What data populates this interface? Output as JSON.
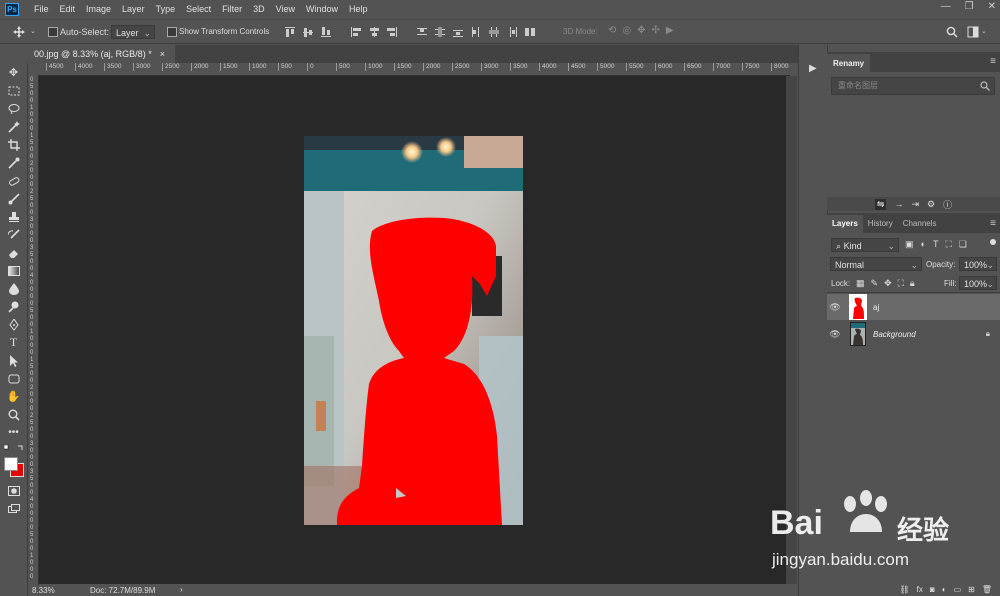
{
  "app": {
    "logo_text": "Ps"
  },
  "menu": [
    "File",
    "Edit",
    "Image",
    "Layer",
    "Type",
    "Select",
    "Filter",
    "3D",
    "View",
    "Window",
    "Help"
  ],
  "options_bar": {
    "auto_select_label": "Auto-Select:",
    "auto_select_target": "Layer",
    "show_transform_label": "Show Transform Controls",
    "mode_3d_label": "3D Mode:"
  },
  "document": {
    "tab_title": "00.jpg @ 8.33% (aj, RGB/8) *",
    "close_glyph": "×"
  },
  "ruler": {
    "h_labels": [
      "4500",
      "4000",
      "3500",
      "3000",
      "2500",
      "2000",
      "1500",
      "1000",
      "500",
      "0",
      "500",
      "1000",
      "1500",
      "2000",
      "2500",
      "3000",
      "3500",
      "4000",
      "4500",
      "5000",
      "5500",
      "6000",
      "6500",
      "7000",
      "7500",
      "8000"
    ]
  },
  "status": {
    "zoom": "8.33%",
    "doc": "Doc: 72.7M/89.9M",
    "arrow": "›"
  },
  "renamy": {
    "tab": "Renamy",
    "search_placeholder": "重命名图层"
  },
  "layers_panel": {
    "tabs": [
      "Layers",
      "History",
      "Channels"
    ],
    "filter_kind": "Kind",
    "blend_mode": "Normal",
    "opacity_label": "Opacity:",
    "opacity_value": "100%",
    "lock_label": "Lock:",
    "fill_label": "Fill:",
    "fill_value": "100%",
    "layers": [
      {
        "name": "aj",
        "selected": true
      },
      {
        "name": "Background",
        "selected": false
      }
    ]
  },
  "watermark": {
    "brand": "Bai",
    "brand2": "经验",
    "url": "jingyan.baidu.com"
  },
  "colors": {
    "foreground": "#ffffff",
    "background": "#e60000",
    "selection_red": "#ff0000"
  }
}
